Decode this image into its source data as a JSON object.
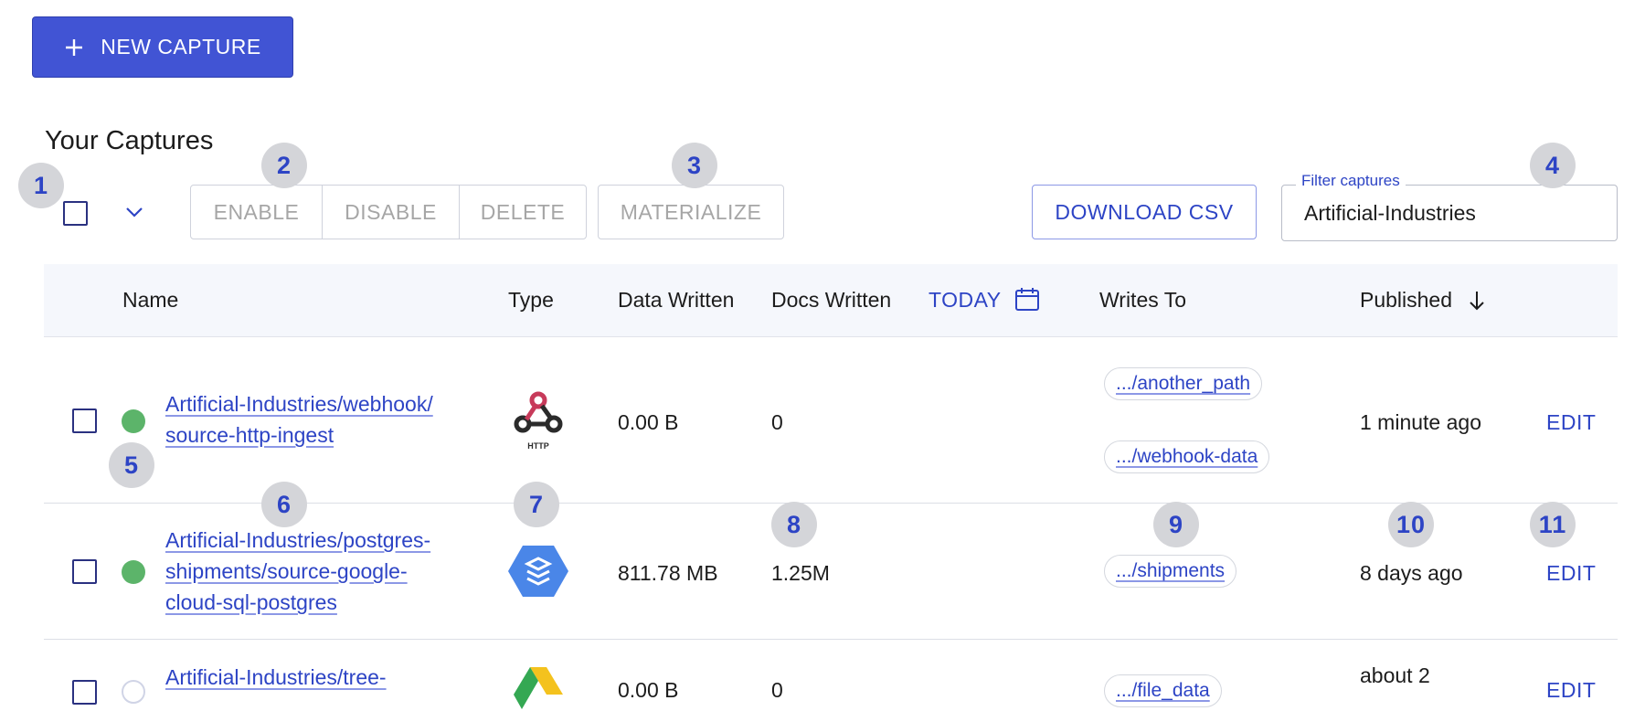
{
  "header": {
    "new_capture_label": "NEW CAPTURE",
    "title": "Your Captures"
  },
  "toolbar": {
    "enable_label": "ENABLE",
    "disable_label": "DISABLE",
    "delete_label": "DELETE",
    "materialize_label": "MATERIALIZE",
    "download_csv_label": "DOWNLOAD CSV",
    "filter_label": "Filter captures",
    "filter_value": "Artificial-Industries"
  },
  "badges": [
    "1",
    "2",
    "3",
    "4",
    "5",
    "6",
    "7",
    "8",
    "9",
    "10",
    "11"
  ],
  "table": {
    "headers": {
      "name": "Name",
      "type": "Type",
      "data_written": "Data Written",
      "docs_written": "Docs Written",
      "today": "TODAY",
      "writes_to": "Writes To",
      "published": "Published"
    },
    "rows": [
      {
        "name_line1": "Artificial-Industries/webhook/",
        "name_line2": "source-http-ingest",
        "type_icon": "http-webhook-icon",
        "type_caption": "HTTP",
        "data_written": "0.00 B",
        "docs_written": "0",
        "writes_to": [
          ".../another_path",
          ".../webhook-data"
        ],
        "published": "1 minute ago",
        "edit_label": "EDIT",
        "status_color": "#5cb46a"
      },
      {
        "name_line1": "Artificial-Industries/postgres-",
        "name_line2": "shipments/source-google-",
        "name_line3": "cloud-sql-postgres",
        "type_icon": "google-cloud-sql-icon",
        "data_written": "811.78 MB",
        "docs_written": "1.25M",
        "writes_to": [
          ".../shipments"
        ],
        "published": "8 days ago",
        "edit_label": "EDIT",
        "status_color": "#5cb46a"
      },
      {
        "name_line1": "Artificial-Industries/tree-",
        "type_icon": "google-drive-icon",
        "data_written": "0.00 B",
        "docs_written": "0",
        "writes_to": [
          ".../file_data"
        ],
        "published": "about 2",
        "edit_label": "EDIT",
        "status_color": "#d0d4e6"
      }
    ]
  },
  "colors": {
    "primary": "#4154d4",
    "link": "#2d44c5",
    "status_ok": "#5cb46a",
    "badge_bg": "#d4d5d9"
  }
}
